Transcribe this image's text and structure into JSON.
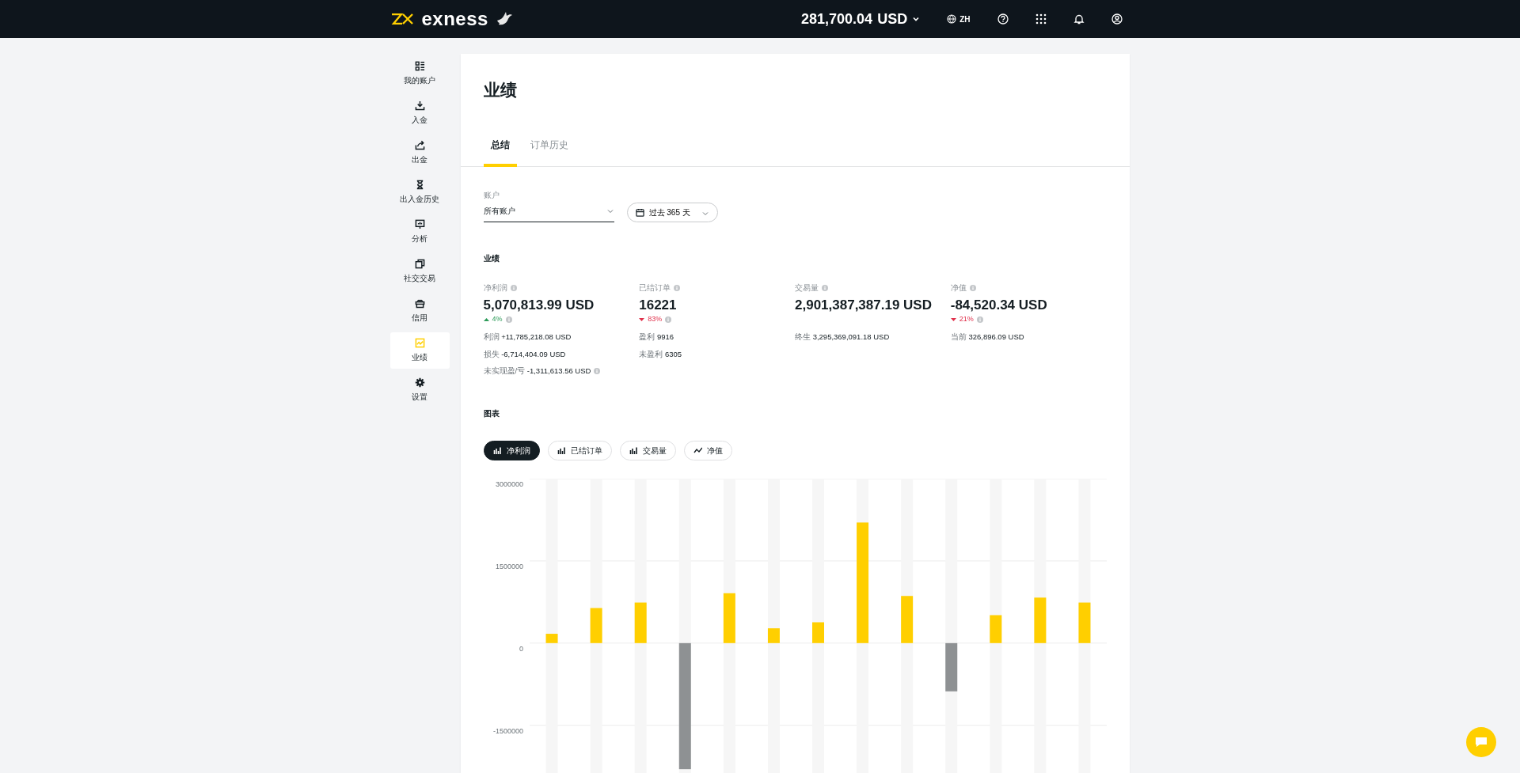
{
  "header": {
    "logo_text": "exness",
    "balance": "281,700.04",
    "currency": "USD",
    "language": "ZH"
  },
  "sidebar": {
    "items": [
      {
        "label": "我的账户",
        "selected": false
      },
      {
        "label": "入金",
        "selected": false
      },
      {
        "label": "出金",
        "selected": false
      },
      {
        "label": "出入金历史",
        "selected": false
      },
      {
        "label": "分析",
        "selected": false
      },
      {
        "label": "社交交易",
        "selected": false
      },
      {
        "label": "信用",
        "selected": false
      },
      {
        "label": "业绩",
        "selected": true
      },
      {
        "label": "设置",
        "selected": false
      }
    ]
  },
  "page": {
    "title": "业绩",
    "tabs": [
      {
        "label": "总结",
        "selected": true
      },
      {
        "label": "订单历史",
        "selected": false
      }
    ],
    "account_select": {
      "label": "账户",
      "value": "所有账户"
    },
    "period_select": {
      "value": "过去 365 天"
    },
    "summary_title": "业绩",
    "stats": [
      {
        "label": "净利润",
        "value": "5,070,813.99 USD",
        "change": {
          "positive": true,
          "text": "4%"
        },
        "details": [
          {
            "label": "利润",
            "value": "+11,785,218.08 USD",
            "info": false
          },
          {
            "label": "损失",
            "value": "-6,714,404.09 USD",
            "info": false
          },
          {
            "label": "未实现盈/亏",
            "value": "-1,311,613.56 USD",
            "info": true
          }
        ]
      },
      {
        "label": "已结订单",
        "value": "16221",
        "change": {
          "positive": false,
          "text": "83%"
        },
        "details": [
          {
            "label": "盈利",
            "value": "9916",
            "info": false
          },
          {
            "label": "未盈利",
            "value": "6305",
            "info": false
          }
        ]
      },
      {
        "label": "交易量",
        "value": "2,901,387,387.19 USD",
        "details": [
          {
            "label": "终生",
            "value": "3,295,369,091.18 USD",
            "info": false
          }
        ]
      },
      {
        "label": "净值",
        "value": "-84,520.34 USD",
        "change": {
          "positive": false,
          "text": "21%"
        },
        "details": [
          {
            "label": "当前",
            "value": "326,896.09 USD",
            "info": false
          }
        ]
      }
    ],
    "chart_title": "图表",
    "chart_tabs": [
      {
        "label": "净利润",
        "selected": true,
        "kind": "bar"
      },
      {
        "label": "已结订单",
        "selected": false,
        "kind": "bar"
      },
      {
        "label": "交易量",
        "selected": false,
        "kind": "bar"
      },
      {
        "label": "净值",
        "selected": false,
        "kind": "line"
      }
    ],
    "chart_data": {
      "type": "bar",
      "grid": true,
      "values": [
        170000,
        640000,
        740000,
        -2300000,
        910000,
        270000,
        380000,
        2200000,
        860000,
        -880000,
        510000,
        830000,
        740000
      ],
      "ylim": [
        -2370000,
        3000000
      ],
      "yticks": [
        -1500000,
        0,
        1500000,
        3000000
      ]
    }
  }
}
